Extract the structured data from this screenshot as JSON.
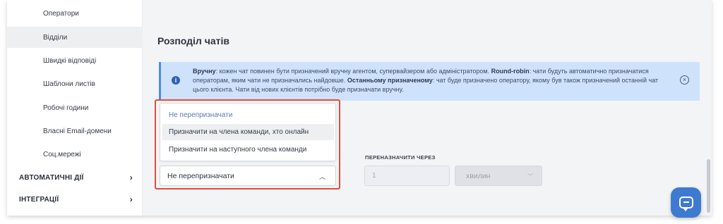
{
  "sidebar": {
    "items": [
      {
        "label": "Оператори"
      },
      {
        "label": "Відділи"
      },
      {
        "label": "Швидкі відповіді"
      },
      {
        "label": "Шаблони листів"
      },
      {
        "label": "Робочі години"
      },
      {
        "label": "Власні Email-домени"
      },
      {
        "label": "Соц.мережі"
      }
    ],
    "active_item": "Відділи",
    "sections": [
      {
        "label": "АВТОМАТИЧНІ ДІЇ",
        "icon": "chevron-right-icon"
      },
      {
        "label": "ІНТЕГРАЦІЇ",
        "icon": "chevron-right-icon"
      }
    ]
  },
  "main": {
    "title": "Розподіл чатів",
    "info": {
      "manual_label": "Вручну",
      "manual_text": ": кожен чат повинен бути призначений вручну агентом, супервайзером або адміністратором. ",
      "roundrobin_label": "Round-robin",
      "roundrobin_text": ": чати будуть автоматично призначатися операторам, яким чати не призначались найдовше. ",
      "last_label": "Останньому призначеному",
      "last_text": ": чат буде призначено оператору, якому був також призначений останній чат цього клієнта. Чати від нових клієнтів потрібно буде призначати вручну.",
      "icon": "info-icon",
      "close_icon": "close-circle-icon"
    },
    "dropdown": {
      "options": [
        "Не перепризначати",
        "Призначити на члена команди, хто онлайн",
        "Призначити на наступного члена команди"
      ],
      "selected": "Не перепризначати",
      "hovered": "Призначити на члена команди, хто онлайн",
      "current_value": "Не перепризначати",
      "chevron": "chevron-up-icon"
    },
    "reassign": {
      "label": "ПЕРЕНАЗНАЧИТИ ЧЕРЕЗ",
      "value": "1",
      "unit": "хвилин",
      "unit_chevron": "chevron-down-icon"
    }
  },
  "colors": {
    "highlight_border": "#e24b3b",
    "info_bg": "#cfe2fc",
    "info_accent": "#4a8ee6",
    "chat_button": "#3e7ad0"
  },
  "chat_widget": {
    "icon": "chat-bubble-icon"
  }
}
